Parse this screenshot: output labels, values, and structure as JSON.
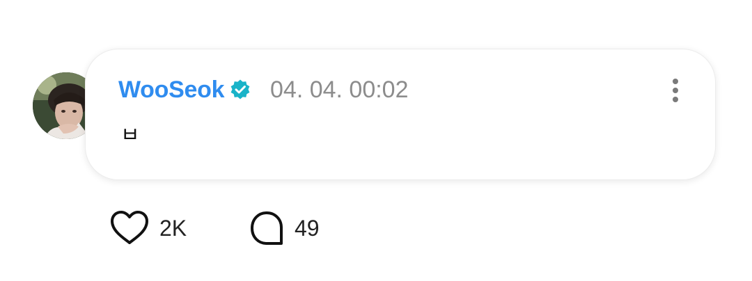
{
  "post": {
    "author": "WooSeok",
    "verified": true,
    "timestamp": "04. 04. 00:02",
    "message": "ㅂ"
  },
  "actions": {
    "likes": "2K",
    "comments": "49"
  },
  "icons": {
    "verified": "verified-badge-icon",
    "more": "more-vertical-icon",
    "like": "heart-outline-icon",
    "comment": "speech-bubble-outline-icon"
  },
  "colors": {
    "author": "#2f8cef",
    "verified_badge": "#1ab3c8",
    "timestamp": "#8c8c8c",
    "text": "#111111"
  }
}
